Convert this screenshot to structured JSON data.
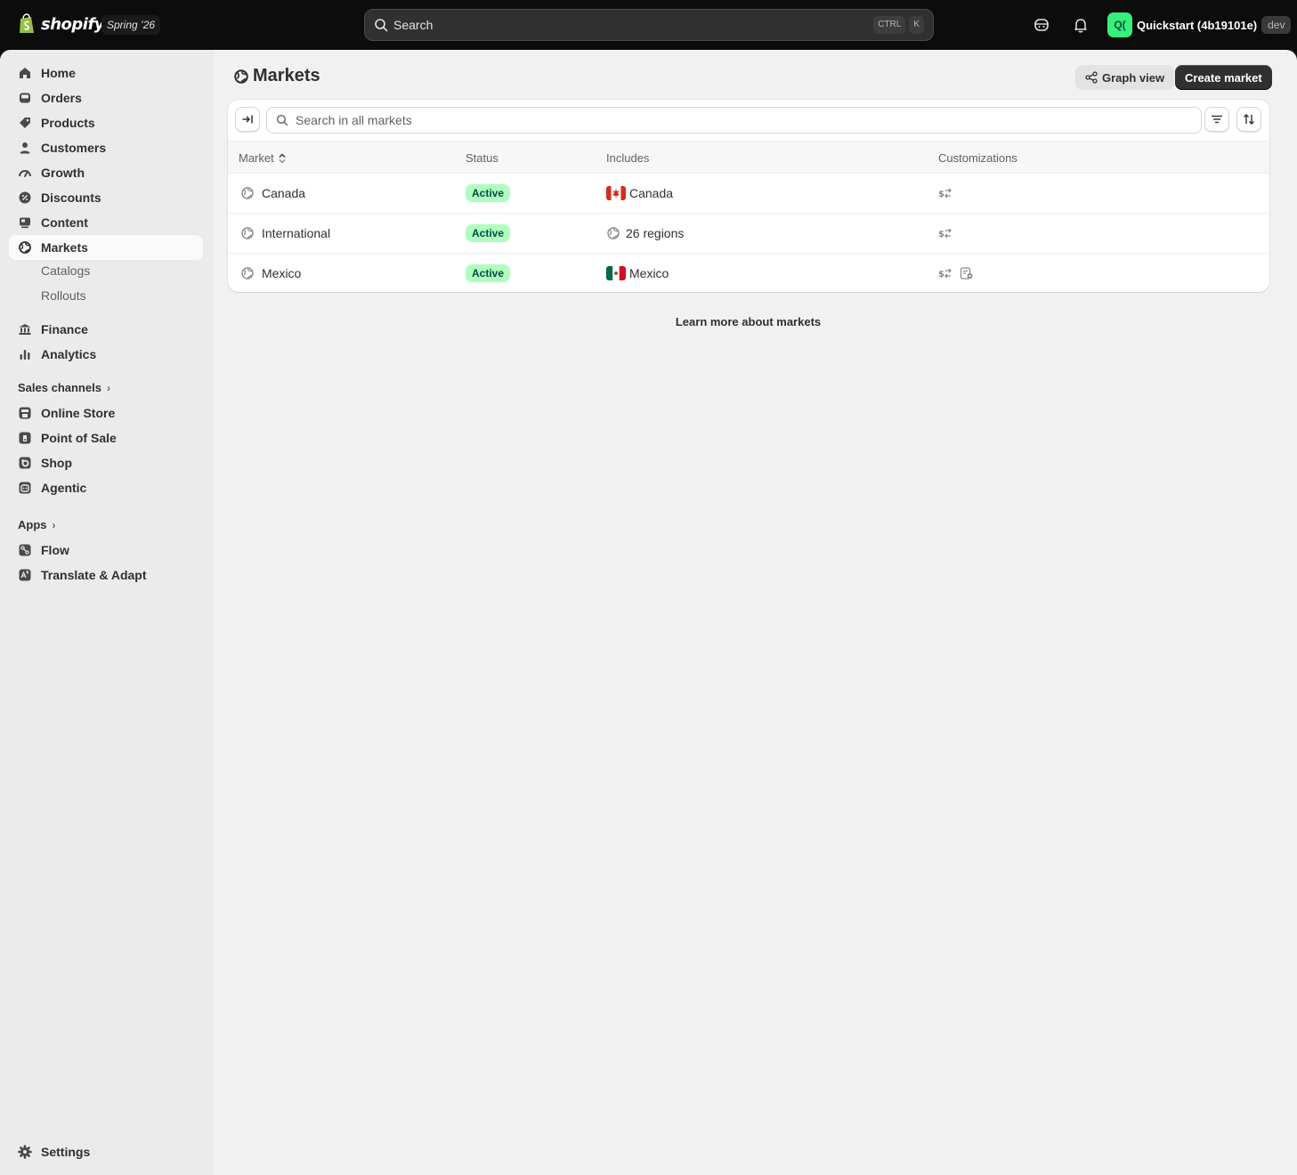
{
  "topbar": {
    "brand": "shopify",
    "edition": "Spring ’26",
    "search": {
      "placeholder": "Search",
      "shortcut_mod": "CTRL",
      "shortcut_key": "K"
    },
    "store": {
      "initials": "Q(",
      "name": "Quickstart (4b19101e)",
      "badge": "dev"
    }
  },
  "sidebar": {
    "items": [
      {
        "label": "Home",
        "icon": "home-icon"
      },
      {
        "label": "Orders",
        "icon": "inbox-icon"
      },
      {
        "label": "Products",
        "icon": "tag-icon"
      },
      {
        "label": "Customers",
        "icon": "person-icon"
      },
      {
        "label": "Growth",
        "icon": "gauge-icon"
      },
      {
        "label": "Discounts",
        "icon": "discount-icon"
      },
      {
        "label": "Content",
        "icon": "content-icon"
      },
      {
        "label": "Markets",
        "icon": "globe-icon"
      }
    ],
    "sub_items": [
      "Catalogs",
      "Rollouts"
    ],
    "items2": [
      {
        "label": "Finance",
        "icon": "bank-icon"
      },
      {
        "label": "Analytics",
        "icon": "bar-chart-icon"
      }
    ],
    "sales_channels_label": "Sales channels",
    "sales_channels": [
      {
        "label": "Online Store",
        "icon": "store-icon"
      },
      {
        "label": "Point of Sale",
        "icon": "pos-icon"
      },
      {
        "label": "Shop",
        "icon": "shop-icon"
      },
      {
        "label": "Agentic",
        "icon": "agentic-icon"
      }
    ],
    "apps_label": "Apps",
    "apps": [
      {
        "label": "Flow",
        "icon": "flow-icon"
      },
      {
        "label": "Translate & Adapt",
        "icon": "translate-icon"
      }
    ],
    "settings_label": "Settings"
  },
  "page": {
    "title": "Markets",
    "graph_view_label": "Graph view",
    "create_label": "Create market",
    "search_placeholder": "Search in all markets",
    "learn_more": "Learn more about markets"
  },
  "table": {
    "columns": [
      "Market",
      "Status",
      "Includes",
      "Customizations"
    ],
    "rows": [
      {
        "market": "Canada",
        "status": "Active",
        "includes": "Canada",
        "includes_icon": "canada-flag-icon",
        "customizations": [
          "currency-icon"
        ]
      },
      {
        "market": "International",
        "status": "Active",
        "includes": "26 regions",
        "includes_icon": "globe-icon",
        "customizations": [
          "currency-icon"
        ]
      },
      {
        "market": "Mexico",
        "status": "Active",
        "includes": "Mexico",
        "includes_icon": "mexico-flag-icon",
        "customizations": [
          "currency-icon",
          "catalog-icon"
        ]
      }
    ]
  },
  "colors": {
    "topbar_bg": "#0c0c0c",
    "frame_bg": "#f1f1f1",
    "sidebar_bg": "#ebebeb",
    "badge_active_bg": "#affebf",
    "badge_active_text": "#014b40",
    "store_avatar": "#36f07b",
    "primary_button": "#303030"
  }
}
